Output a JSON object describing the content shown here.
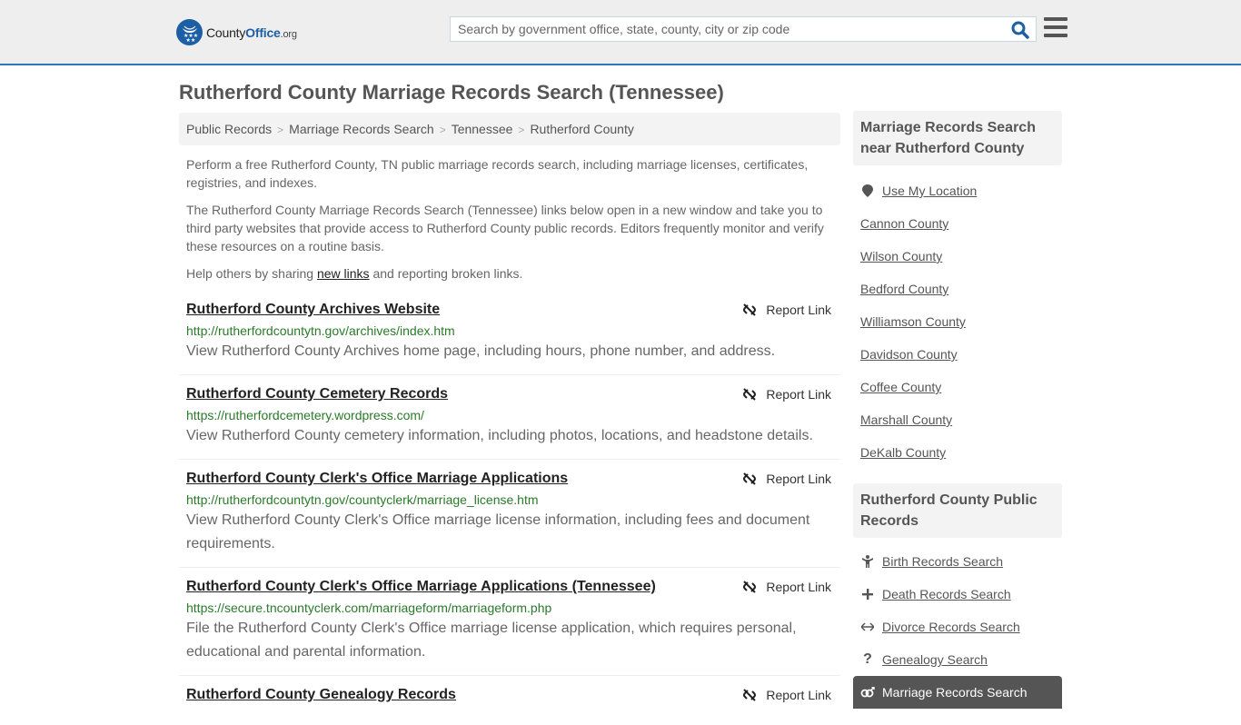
{
  "header": {
    "logo": {
      "name_part1": "County",
      "name_part2": "Office",
      "tld": ".org"
    },
    "search": {
      "placeholder": "Search by government office, state, county, city or zip code",
      "value": ""
    },
    "icons": {
      "search": "search-icon",
      "menu": "hamburger-menu-icon"
    }
  },
  "page_title": "Rutherford County Marriage Records Search (Tennessee)",
  "breadcrumb": [
    "Public Records",
    "Marriage Records Search",
    "Tennessee",
    "Rutherford County"
  ],
  "intro": {
    "p1": "Perform a free Rutherford County, TN public marriage records search, including marriage licenses, certificates, registries, and indexes.",
    "p2": "The Rutherford County Marriage Records Search (Tennessee) links below open in a new window and take you to third party websites that provide access to Rutherford County public records. Editors frequently monitor and verify these resources on a routine basis.",
    "p3_before": "Help others by sharing ",
    "p3_link": "new links",
    "p3_after": " and reporting broken links."
  },
  "report_label": "Report Link",
  "results": [
    {
      "title": "Rutherford County Archives Website",
      "url": "http://rutherfordcountytn.gov/archives/index.htm",
      "desc": "View Rutherford County Archives home page, including hours, phone number, and address."
    },
    {
      "title": "Rutherford County Cemetery Records",
      "url": "https://rutherfordcemetery.wordpress.com/",
      "desc": "View Rutherford County cemetery information, including photos, locations, and headstone details."
    },
    {
      "title": "Rutherford County Clerk's Office Marriage Applications",
      "url": "http://rutherfordcountytn.gov/countyclerk/marriage_license.htm",
      "desc": "View Rutherford County Clerk's Office marriage license information, including fees and document requirements."
    },
    {
      "title": "Rutherford County Clerk's Office Marriage Applications (Tennessee)",
      "url": "https://secure.tncountyclerk.com/marriageform/marriageform.php",
      "desc": "File the Rutherford County Clerk's Office marriage license application, which requires personal, educational and parental information."
    },
    {
      "title": "Rutherford County Genealogy Records",
      "url": "",
      "desc": ""
    }
  ],
  "sidebar": {
    "nearby": {
      "heading": "Marriage Records Search near Rutherford County",
      "use_location": "Use My Location",
      "counties": [
        "Cannon County",
        "Wilson County",
        "Bedford County",
        "Williamson County",
        "Davidson County",
        "Coffee County",
        "Marshall County",
        "DeKalb County"
      ]
    },
    "public_records": {
      "heading": "Rutherford County Public Records",
      "items": [
        {
          "label": "Birth Records Search",
          "icon": "child-icon"
        },
        {
          "label": "Death Records Search",
          "icon": "plus-icon"
        },
        {
          "label": "Divorce Records Search",
          "icon": "arrows-horizontal-icon"
        },
        {
          "label": "Genealogy Search",
          "icon": "question-icon"
        },
        {
          "label": "Marriage Records Search",
          "icon": "gender-rings-icon",
          "active": true
        }
      ]
    }
  },
  "colors": {
    "brand_blue": "#1c5fa5",
    "header_border": "#3079b5",
    "url_green": "#2a7a2a",
    "active_bg": "#555555"
  }
}
